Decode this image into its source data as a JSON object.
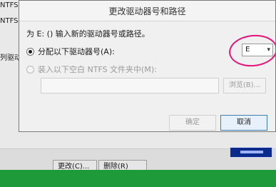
{
  "background": {
    "labels_top": [
      "NTFS",
      "NTFS"
    ],
    "label_mid": "列驱动器",
    "buttons": [
      "更改(C)...",
      "删除(R)"
    ]
  },
  "dialog": {
    "title": "更改驱动器号和路径",
    "prompt": "为 E: () 输入新的驱动器号或路径。",
    "option_assign_letter": "分配以下驱动器号(A):",
    "option_mount_folder": "装入以下空白 NTFS 文件夹中(M):",
    "drive_letter": "E",
    "folder_path_value": "",
    "browse_label": "浏览(B)...",
    "ok_label": "确定",
    "cancel_label": "取消"
  },
  "colors": {
    "annotation_circle": "#e4147a",
    "taskbar_green": "#1f9a3a",
    "selection_blue": "#0b2b8c"
  },
  "icons": {
    "dropdown": "chevron-down-icon"
  }
}
